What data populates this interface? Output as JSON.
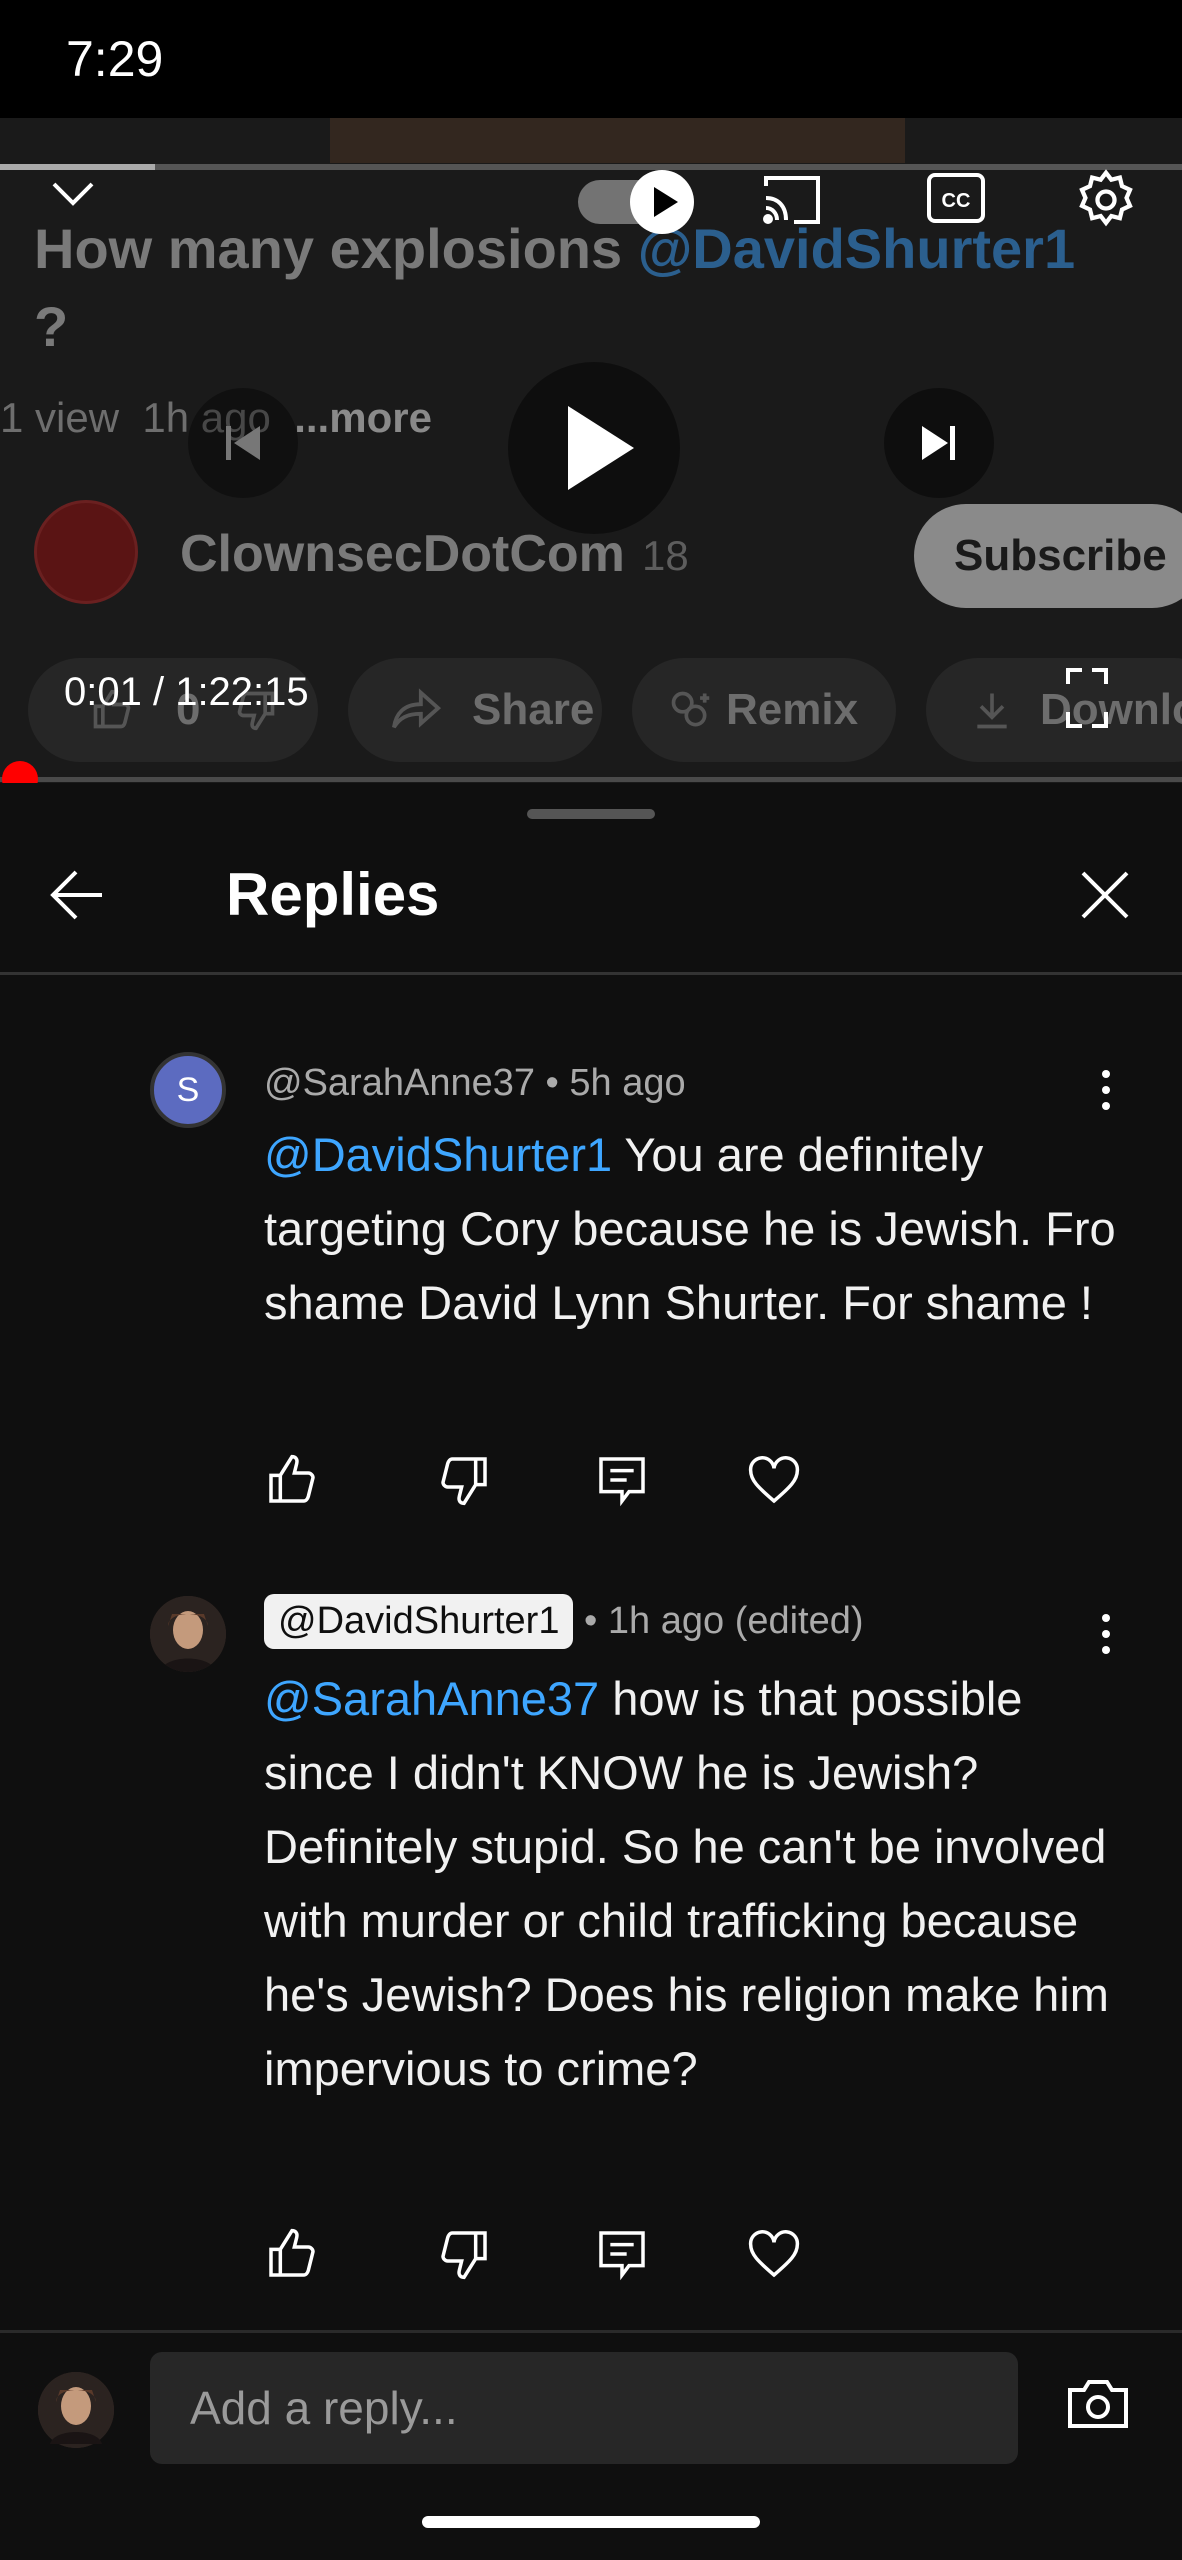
{
  "status_bar": {
    "time": "7:29"
  },
  "player": {
    "time_display": "0:01 / 1:22:15",
    "progress_fraction": 0.0
  },
  "video": {
    "title_text": "How many explosions ",
    "title_mention": "@DavidShurter1",
    "title_suffix": "?",
    "views": "1 view",
    "age": "1h ago",
    "more_label": "...more"
  },
  "channel": {
    "name": "ClownsecDotCom",
    "subscribers": "18",
    "subscribe_label": "Subscribe"
  },
  "actions_row": {
    "like_count": "0",
    "share_label": "Share",
    "remix_label": "Remix",
    "download_label": "Downlo"
  },
  "replies_panel": {
    "title": "Replies",
    "comments": [
      {
        "avatar_letter": "S",
        "author": "@SarahAnne37",
        "meta": " • 5h ago",
        "mention": "@DavidShurter1",
        "text": "  You are definitely targeting Cory because he is Jewish. Fro shame David Lynn Shurter. For shame !"
      },
      {
        "author": "@DavidShurter1",
        "meta": " • 1h ago (edited)",
        "mention": "@SarahAnne37",
        "text": " how is that possible since I didn't KNOW he is Jewish? Definitely stupid. So he can't be involved with murder or child trafficking because he's Jewish? Does his religion make him impervious to crime?"
      }
    ],
    "reply_placeholder": "Add a reply..."
  },
  "icons": {
    "collapse": "chevron-down-icon",
    "cast": "cast-icon",
    "captions": "closed-captions-icon",
    "settings": "gear-icon",
    "like": "thumbs-up-icon",
    "dislike": "thumbs-down-icon",
    "reply": "reply-icon",
    "heart": "heart-icon",
    "camera": "camera-icon"
  },
  "colors": {
    "mention": "#3ea6ff",
    "progress": "#ff0000",
    "background": "#0f0f0f"
  }
}
